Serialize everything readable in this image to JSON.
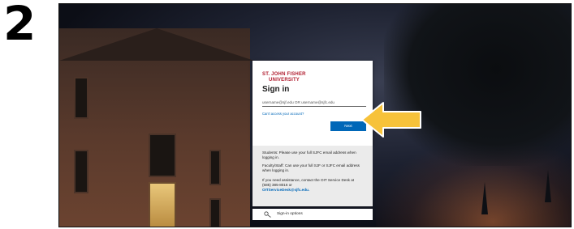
{
  "step": {
    "number": "2"
  },
  "login": {
    "logo_line1": "ST. JOHN FISHER",
    "logo_line2": "UNIVERSITY",
    "title": "Sign in",
    "username_placeholder": "username@sjf.edu OR username@sjfc.edu",
    "cant_access_link": "Can't access your account?",
    "next_button": "Next"
  },
  "info": {
    "students": "Students: Please use your full SJFC email address when logging in.",
    "faculty": "Faculty/Staff: Can use your full SJF or SJFC email address when logging in.",
    "assistance": "If you need assistance, contact the OIT Service Desk at (585) 385-8016 or",
    "assistance_email": "OITServiceDesk@sjfc.edu."
  },
  "signin_options": {
    "label": "Sign-in options",
    "icon": "key-icon"
  },
  "colors": {
    "brand": "#b01c2e",
    "accent": "#0067b8",
    "arrow": "#f7c23a"
  }
}
